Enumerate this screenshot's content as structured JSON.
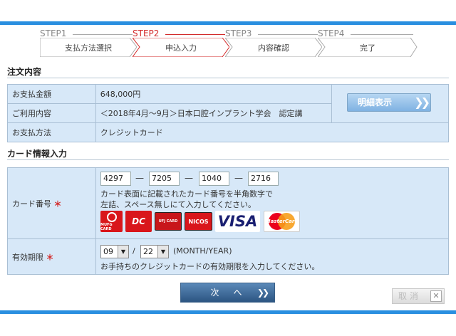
{
  "steps": [
    {
      "head": "STEP1",
      "label": "支払方法選択",
      "active": false
    },
    {
      "head": "STEP2",
      "label": "申込入力",
      "active": true
    },
    {
      "head": "STEP3",
      "label": "内容確認",
      "active": false
    },
    {
      "head": "STEP4",
      "label": "完了",
      "active": false
    }
  ],
  "order": {
    "title": "注文内容",
    "rows": [
      {
        "label": "お支払金額",
        "value": "648,000円"
      },
      {
        "label": "ご利用内容",
        "value": "＜2018年4月〜9月＞日本口腔インプラント学会　認定講"
      },
      {
        "label": "お支払方法",
        "value": "クレジットカード"
      }
    ],
    "detail_button": "明細表示",
    "detail_arrows": "❯❯"
  },
  "card": {
    "title": "カード情報入力",
    "number_label": "カード番号",
    "required_mark": "＊",
    "number_parts": [
      "4297",
      "7205",
      "1040",
      "2716"
    ],
    "dash": "—",
    "number_note_1": "カード表面に記載されたカード番号を半角数字で",
    "number_note_2": "左詰、スペース無しにて入力してください。",
    "logos": [
      {
        "name": "MUFG CARD",
        "color": "#d9161b"
      },
      {
        "name": "DC",
        "color": "#d9161b"
      },
      {
        "name": "UFJ CARD",
        "color": "#c8161b"
      },
      {
        "name": "NICOS",
        "color": "#d9161b"
      },
      {
        "name": "VISA",
        "color": "#1a1f71"
      },
      {
        "name": "MasterCard",
        "color": "#eb001b"
      }
    ],
    "expiry_label": "有効期限",
    "expiry_month": "09",
    "expiry_sep": "/",
    "expiry_year": "22",
    "expiry_format": "(MONTH/YEAR)",
    "expiry_note": "お手持ちのクレジットカードの有効期限を入力してください。"
  },
  "actions": {
    "next": "次　へ",
    "next_arrows": "❯❯",
    "cancel": "取消",
    "cancel_x": "✕"
  },
  "colors": {
    "accent": "#2a8fe0",
    "active_step": "#d32a2a",
    "cell_bg": "#d7e8f8"
  }
}
